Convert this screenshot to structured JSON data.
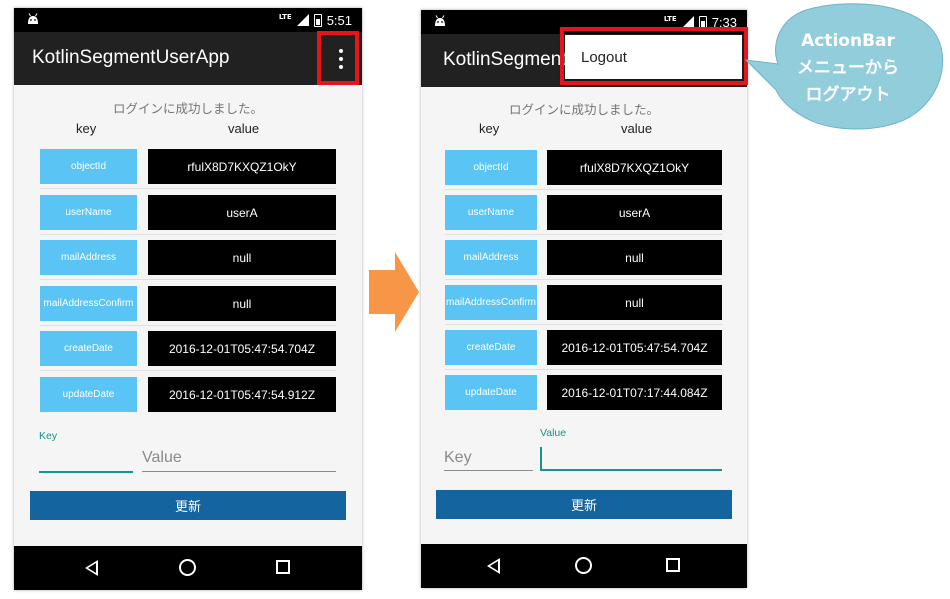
{
  "left_screen": {
    "status_time": "5:51",
    "network_label": "LTE",
    "app_title": "KotlinSegmentUserApp",
    "message": "ログインに成功しました。",
    "col_key": "key",
    "col_value": "value",
    "rows": [
      {
        "key": "objectId",
        "value": "rfulX8D7KXQZ1OkY"
      },
      {
        "key": "userName",
        "value": "userA"
      },
      {
        "key": "mailAddress",
        "value": "null"
      },
      {
        "key": "mailAddressConfirm",
        "value": "null"
      },
      {
        "key": "createDate",
        "value": "2016-12-01T05:47:54.704Z"
      },
      {
        "key": "updateDate",
        "value": "2016-12-01T05:47:54.912Z"
      }
    ],
    "key_floating_label": "Key",
    "value_placeholder": "Value",
    "update_button": "更新"
  },
  "right_screen": {
    "status_time": "7:33",
    "network_label": "LTE",
    "app_title": "KotlinSegment",
    "menu_item_logout": "Logout",
    "message": "ログインに成功しました。",
    "col_key": "key",
    "col_value": "value",
    "rows": [
      {
        "key": "objectId",
        "value": "rfulX8D7KXQZ1OkY"
      },
      {
        "key": "userName",
        "value": "userA"
      },
      {
        "key": "mailAddress",
        "value": "null"
      },
      {
        "key": "mailAddressConfirm",
        "value": "null"
      },
      {
        "key": "createDate",
        "value": "2016-12-01T05:47:54.704Z"
      },
      {
        "key": "updateDate",
        "value": "2016-12-01T07:17:44.084Z"
      }
    ],
    "key_placeholder": "Key",
    "value_floating_label": "Value",
    "update_button": "更新"
  },
  "callout": {
    "line1": "ActionBar",
    "line2": "メニューから",
    "line3": "ログアウト"
  },
  "colors": {
    "key_button": "#5ac4f5",
    "value_box": "#000000",
    "accent": "#18928a",
    "update_button": "#1464a0",
    "highlight": "#e8141c",
    "arrow": "#f79646",
    "callout": "#92cddc"
  },
  "icons": {
    "status": [
      "android-icon",
      "signal-icon",
      "battery-icon"
    ],
    "navigation": [
      "back-icon",
      "home-icon",
      "recents-icon"
    ],
    "action_bar": "overflow-menu-icon"
  }
}
